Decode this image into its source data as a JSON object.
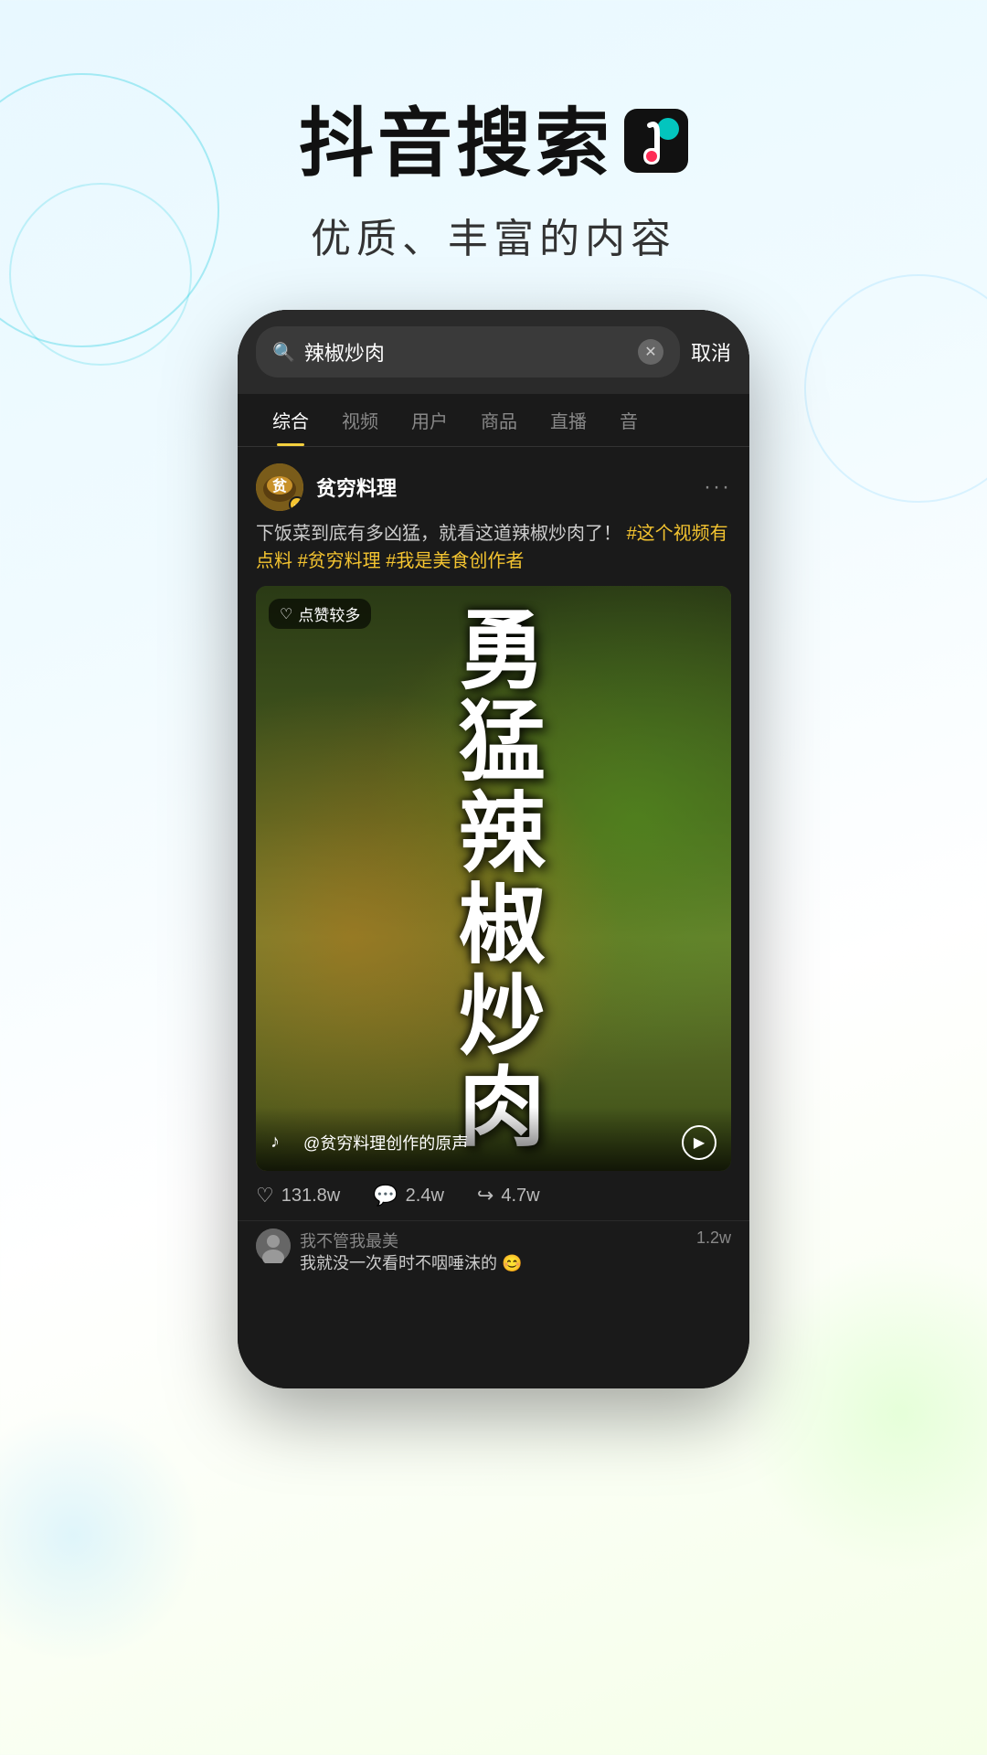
{
  "header": {
    "title": "抖音搜索",
    "subtitle": "优质、丰富的内容",
    "tiktok_icon": "♪"
  },
  "phone": {
    "search": {
      "placeholder": "辣椒炒肉",
      "query": "辣椒炒肉",
      "cancel_label": "取消"
    },
    "tabs": [
      {
        "label": "综合",
        "active": true
      },
      {
        "label": "视频",
        "active": false
      },
      {
        "label": "用户",
        "active": false
      },
      {
        "label": "商品",
        "active": false
      },
      {
        "label": "直播",
        "active": false
      },
      {
        "label": "音",
        "active": false
      }
    ],
    "post": {
      "username": "贫穷料理",
      "verified": true,
      "description": "下饭菜到底有多凶猛，就看这道辣椒炒肉了！",
      "hashtags": [
        "#这个视频有点料",
        "#贫穷料理",
        "#我是美食创作者"
      ],
      "video_badge": "点赞较多",
      "video_overlay_lines": [
        "勇",
        "猛",
        "辣",
        "椒",
        "炒",
        "肉"
      ],
      "video_overlay_text": "勇猛辣椒炒肉",
      "sound_text": "@贫穷料理创作的原声",
      "stats": {
        "likes": "131.8w",
        "comments": "2.4w",
        "shares": "4.7w"
      },
      "comment": {
        "name": "我不管我最美",
        "body": "我就没一次看时不咽唾沫的 😊",
        "likes": "1.2w"
      }
    }
  }
}
